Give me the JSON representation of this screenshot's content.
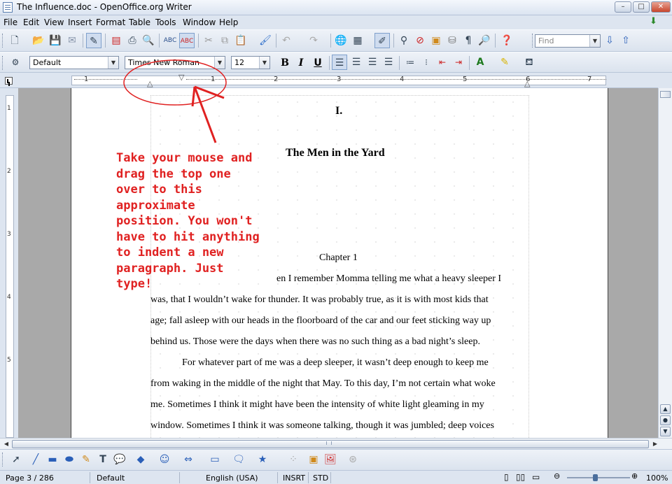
{
  "window": {
    "title": "The Influence.doc - OpenOffice.org Writer",
    "controls": {
      "minimize": "–",
      "maximize": "□",
      "close": "✕"
    }
  },
  "menu": [
    "File",
    "Edit",
    "View",
    "Insert",
    "Format",
    "Table",
    "Tools",
    "Window",
    "Help"
  ],
  "standard_toolbar": {
    "find_placeholder": "Find",
    "icons": [
      "new-document",
      "open",
      "save",
      "email",
      "edit-mode",
      "export-pdf",
      "print",
      "page-preview",
      "spellcheck",
      "autospellcheck",
      "cut",
      "copy",
      "paste",
      "format-paintbrush",
      "undo",
      "redo",
      "hyperlink",
      "table",
      "show-draw-functions",
      "find-replace",
      "navigator",
      "gallery",
      "data-sources",
      "nonprinting-characters",
      "zoom",
      "help"
    ]
  },
  "formatting_toolbar": {
    "style": "Default",
    "font": "Times New Roman",
    "size": "12",
    "bold": "B",
    "italic": "I",
    "underline": "U",
    "align_left_active": true
  },
  "ruler": {
    "numbers": [
      "1",
      "1",
      "2",
      "3",
      "4",
      "5",
      "6",
      "7"
    ]
  },
  "vertical_ruler": {
    "numbers": [
      "1",
      "2",
      "3",
      "4",
      "5"
    ]
  },
  "document": {
    "heading_number": "I.",
    "heading_title": "The Men in the Yard",
    "chapter": "Chapter 1",
    "lines": [
      "en I remember Momma telling me what a heavy sleeper I",
      "was, that I wouldn’t wake for thunder.  It was probably true, as it is with most kids that",
      "age; fall asleep with our heads in the floorboard of the car and our feet sticking way up",
      "behind us.  Those were the days when there was no such thing as a bad night’s sleep.",
      "For whatever part of me was a deep sleeper, it wasn’t deep enough to keep me",
      "from waking in the middle of the night that May.  To this day, I’m not certain what woke",
      "me.  Sometimes I think it might have been the intensity of white light gleaming in my",
      "window.  Sometimes I think it was someone talking, though it was jumbled; deep voices"
    ]
  },
  "annotation": {
    "lines": [
      "Take your mouse and",
      "drag the top one",
      "over to this",
      "approximate",
      "position. You won't",
      "have to hit anything",
      "to indent a new",
      "paragraph. Just",
      "type!"
    ],
    "color": "#e02121"
  },
  "statusbar": {
    "page": "Page 3 / 286",
    "style": "Default",
    "language": "English (USA)",
    "insert_mode": "INSRT",
    "selection_mode": "STD",
    "zoom": "100%"
  },
  "colors": {
    "annotation_red": "#e02121",
    "chrome": "#dde5f0"
  }
}
